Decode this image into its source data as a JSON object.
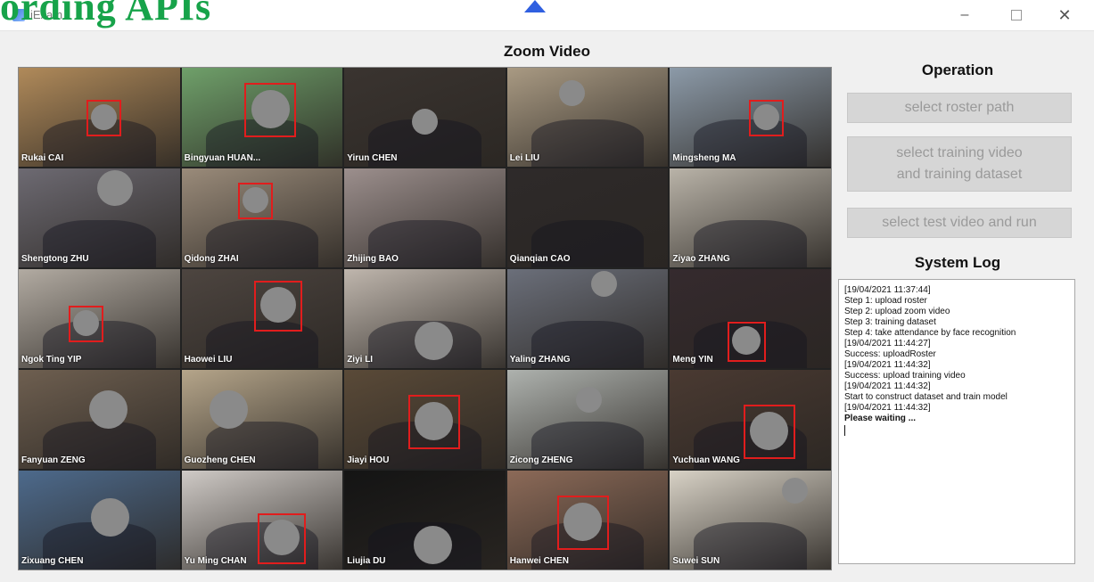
{
  "window": {
    "overlay_text": "ording APIs",
    "app_title": "iExam",
    "controls": {
      "minimize": "–",
      "close": "✕"
    }
  },
  "video": {
    "title": "Zoom Video",
    "tiles": [
      {
        "name": "Rukai CAI",
        "bg": "#b08a5a"
      },
      {
        "name": "Bingyuan HUAN...",
        "bg": "#6fa06a"
      },
      {
        "name": "Yirun CHEN",
        "bg": "#3a3430"
      },
      {
        "name": "Lei LIU",
        "bg": "#a99a83"
      },
      {
        "name": "Mingsheng MA",
        "bg": "#8c9aa8"
      },
      {
        "name": "Shengtong ZHU",
        "bg": "#6d6a72"
      },
      {
        "name": "Qidong ZHAI",
        "bg": "#9a8b7a"
      },
      {
        "name": "Zhijing BAO",
        "bg": "#9c8f8d"
      },
      {
        "name": "Qianqian CAO",
        "bg": "#2e2a2a"
      },
      {
        "name": "Ziyao ZHANG",
        "bg": "#b9b3a8"
      },
      {
        "name": "Ngok Ting YIP",
        "bg": "#b2aba2"
      },
      {
        "name": "Haowei LIU",
        "bg": "#4d4540"
      },
      {
        "name": "Ziyi LI",
        "bg": "#bfb6ad"
      },
      {
        "name": "Yaling ZHANG",
        "bg": "#6b6f7a"
      },
      {
        "name": "Meng YIN",
        "bg": "#352a2e"
      },
      {
        "name": "Fanyuan ZENG",
        "bg": "#6e5f50"
      },
      {
        "name": "Guozheng CHEN",
        "bg": "#b5a58a"
      },
      {
        "name": "Jiayi HOU",
        "bg": "#5a4a38"
      },
      {
        "name": "Zicong ZHENG",
        "bg": "#aeb2ae"
      },
      {
        "name": "Yuchuan WANG",
        "bg": "#4a3a32"
      },
      {
        "name": "Zixuang CHEN",
        "bg": "#4d6a8c"
      },
      {
        "name": "Yu Ming CHAN",
        "bg": "#cfcac6"
      },
      {
        "name": "Liujia DU",
        "bg": "#141414"
      },
      {
        "name": "Hanwei CHEN",
        "bg": "#8c6a58"
      },
      {
        "name": "Suwei SUN",
        "bg": "#d8d2c6"
      }
    ]
  },
  "operation": {
    "title": "Operation",
    "buttons": {
      "roster": "select roster path",
      "training": "select training video\nand training dataset",
      "test": "select test video and run"
    }
  },
  "log": {
    "title": "System Log",
    "lines": [
      "[19/04/2021 11:37:44]",
      "Step 1: upload roster",
      "Step 2: upload zoom video",
      "Step 3: training dataset",
      "Step 4: take attendance by face recognition",
      "[19/04/2021 11:44:27]",
      "Success: uploadRoster",
      "[19/04/2021 11:44:32]",
      "Success: upload training video",
      "[19/04/2021 11:44:32]",
      "Start to construct dataset and train model",
      "[19/04/2021 11:44:32]"
    ],
    "last_line": "Please waiting ..."
  }
}
